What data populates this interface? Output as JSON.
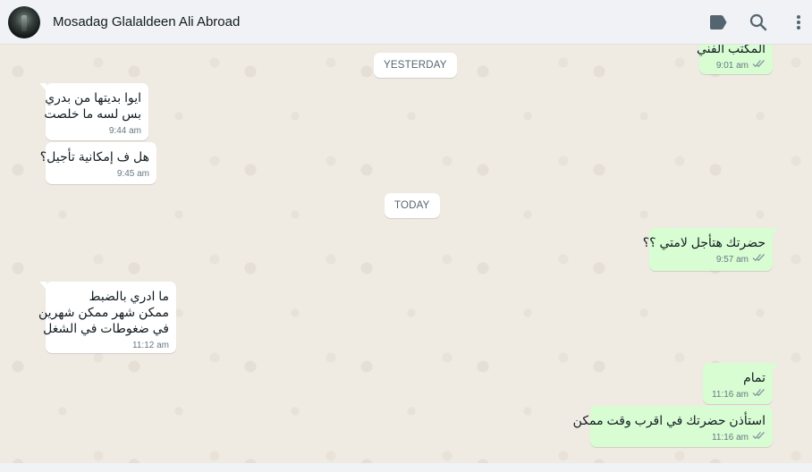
{
  "header": {
    "contact_name": "Mosadag Glalaldeen Ali Abroad",
    "icons": [
      "label-icon",
      "search-icon",
      "more-options-icon"
    ]
  },
  "colors": {
    "incoming_bubble": "#ffffff",
    "outgoing_bubble": "#d9fdd3",
    "read_ticks": "#8696a0",
    "header_bg": "#f0f2f5",
    "chat_bg": "#efeae2"
  },
  "dates": {
    "yesterday": "YESTERDAY",
    "today": "TODAY"
  },
  "messages": [
    {
      "direction": "out",
      "lines": [
        "المكتب الفني"
      ],
      "time": "9:01 am",
      "status": "read"
    },
    {
      "direction": "in",
      "lines": [
        "ايوا بديتها من بدري",
        "بس لسه ما خلصت"
      ],
      "time": "9:44 am"
    },
    {
      "direction": "in",
      "lines": [
        "هل ف إمكانية تأجيل؟"
      ],
      "time": "9:45 am"
    },
    {
      "direction": "out",
      "lines": [
        "حضرتك هتأجل لامتي ؟؟"
      ],
      "time": "9:57 am",
      "status": "read"
    },
    {
      "direction": "in",
      "lines": [
        "ما ادري بالضبط",
        "ممكن شهر ممكن شهرين",
        "في ضغوطات في الشغل"
      ],
      "time": "11:12 am"
    },
    {
      "direction": "out",
      "lines": [
        "تمام"
      ],
      "time": "11:16 am",
      "status": "read"
    },
    {
      "direction": "out",
      "lines": [
        "استأذن حضرتك في اقرب وقت ممكن"
      ],
      "time": "11:16 am",
      "status": "read"
    }
  ]
}
